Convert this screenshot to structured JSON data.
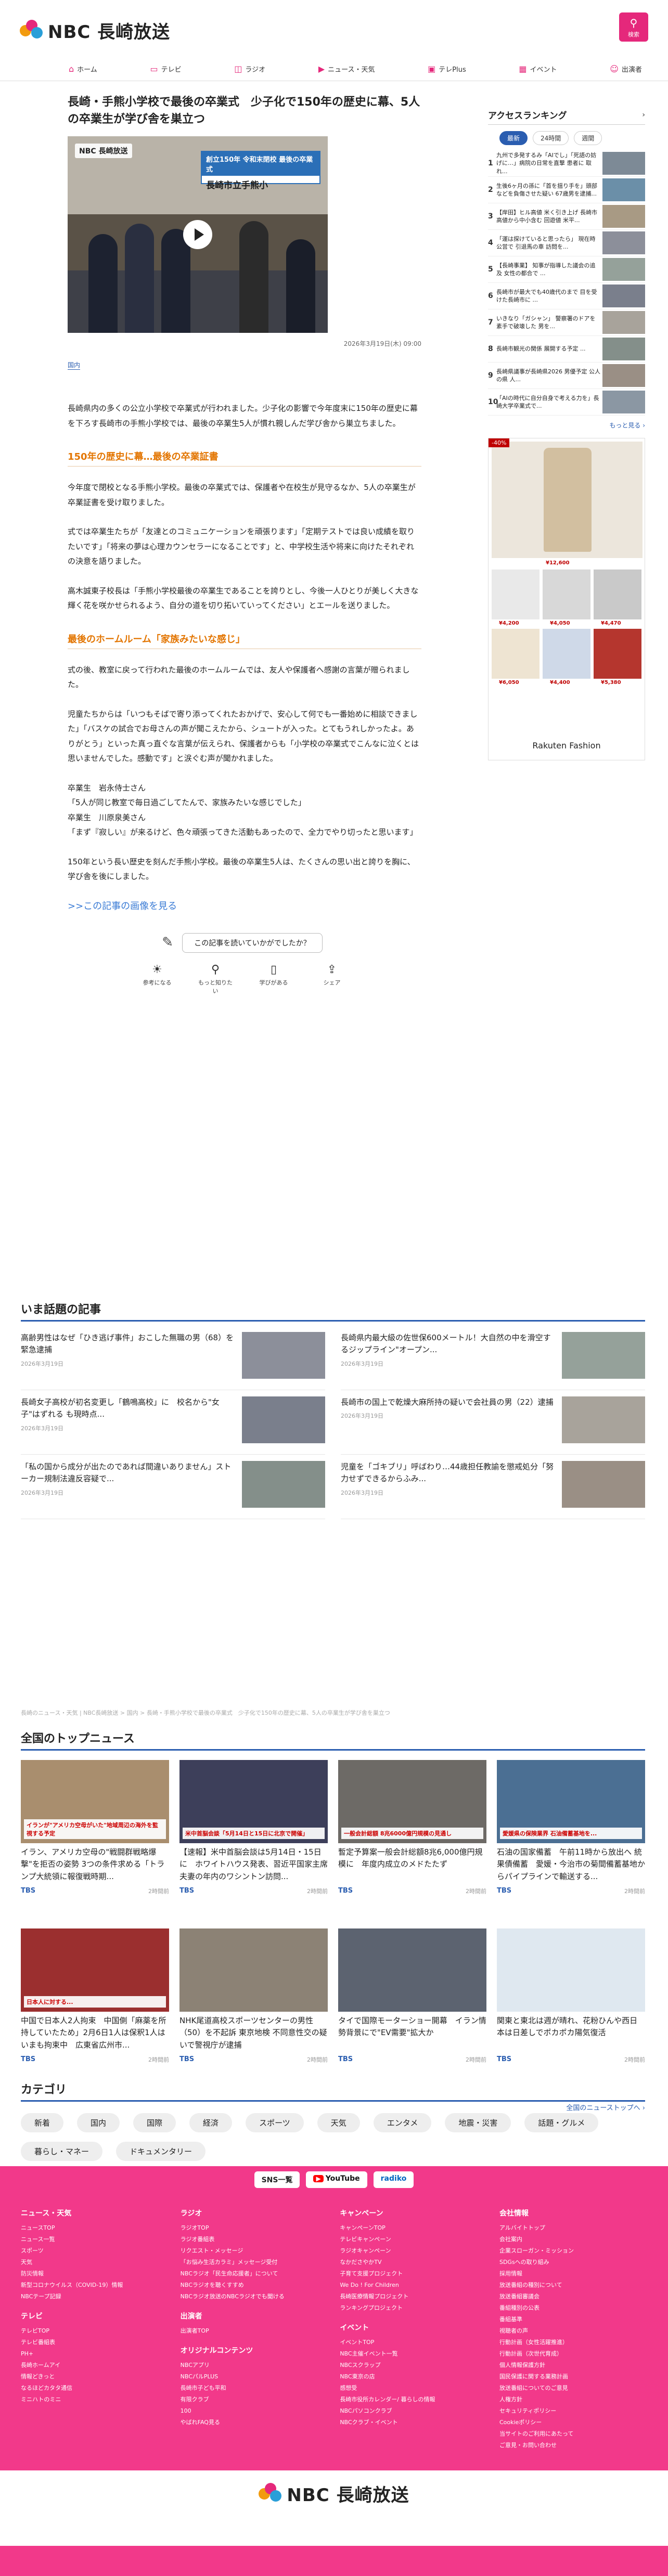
{
  "site": {
    "logo_text": "NBC 長崎放送",
    "search_label": "検索"
  },
  "nav": [
    "ホーム",
    "テレビ",
    "ラジオ",
    "ニュース・天気",
    "テレPlus",
    "イベント",
    "出演者"
  ],
  "article": {
    "headline": "長崎・手熊小学校で最後の卒業式　少子化で150年の歴史に幕、5人の卒業生が学び舎を巣立つ",
    "video_banner_top": "創立150年 令和末閉校 最後の卒業式",
    "video_banner_main": "長崎市立手熊小",
    "video_watermark": "NBC 長崎放送",
    "date": "2026年3月19日(木) 09:00",
    "tag": "国内",
    "p1": "長崎県内の多くの公立小学校で卒業式が行われました。少子化の影響で今年度末に150年の歴史に幕を下ろす長崎市の手熊小学校では、最後の卒業生5人が慣れ親しんだ学び舎から巣立ちました。",
    "h1": "150年の歴史に幕…最後の卒業証書",
    "p2": "今年度で閉校となる手熊小学校。最後の卒業式では、保護者や在校生が見守るなか、5人の卒業生が卒業証書を受け取りました。",
    "p3": "式では卒業生たちが「友達とのコミュニケーションを頑張ります」「定期テストでは良い成績を取りたいです」「将来の夢は心理カウンセラーになることです」と、中学校生活や将来に向けたそれぞれの決意を語りました。",
    "p4": "高木誠東子校長は「手熊小学校最後の卒業生であることを誇りとし、今後一人ひとりが美しく大きな輝く花を咲かせられるよう、自分の道を切り拓いていってください」とエールを送りました。",
    "h2": "最後のホームルーム「家族みたいな感じ」",
    "p5": "式の後、教室に戻って行われた最後のホームルームでは、友人や保護者へ感謝の言葉が贈られました。",
    "p6": "児童たちからは「いつもそばで寄り添ってくれたおかげで、安心して何でも一番始めに相談できました」「バスケの試合でお母さんの声が聞こえたから、シュートが入った。とてもうれしかったよ。ありがとう」といった真っ直ぐな言葉が伝えられ、保護者からも「小学校の卒業式でこんなに泣くとは思いませんでした。感動です」と涙ぐむ声が聞かれました。",
    "p7": "卒業生　岩永侍士さん\n「5人が同じ教室で毎日過ごしてたんで、家族みたいな感じでした」\n卒業生　川原泉美さん\n「まず『寂しい』が来るけど、色々頑張ってきた活動もあったので、全力でやり切ったと思います」",
    "p8": "150年という長い歴史を刻んだ手熊小学校。最後の卒業生5人は、たくさんの思い出と誇りを胸に、学び舎を後にしました。",
    "more_images": ">>この記事の画像を見る"
  },
  "feedback": {
    "question": "この記事を読いていかがでしたか？",
    "reactions": [
      "参考になる",
      "もっと知りたい",
      "学びがある",
      "シェア"
    ]
  },
  "ranking": {
    "title": "アクセスランキング",
    "tabs": [
      "最新",
      "24時間",
      "週間"
    ],
    "items": [
      {
        "n": "1",
        "t": "九州で多発するみ「AIでし」「死語の妨げに…」病院の日常を直撃 患者に 取れ..."
      },
      {
        "n": "2",
        "t": "生後6ヶ月の孫に「首を揺り手を」頭部などを負傷させた疑い 67歳男を逮捕..."
      },
      {
        "n": "3",
        "t": "【岸田】ヒル高値 米く引き上げ 長崎市高値から中小含む 回遊値 米平..."
      },
      {
        "n": "4",
        "t": "「運は探けていると思ったら」 現在時公営で 引退馬の車 訪問を..."
      },
      {
        "n": "5",
        "t": "【長崎事業】 知事が指導した議会の追及 女性の都合で ..."
      },
      {
        "n": "6",
        "t": "長崎市が最大でも40歳代のまで 目を受けた長崎市に ..."
      },
      {
        "n": "7",
        "t": "いきなり「ガシャン」 警察署のドアを素手で破壊した 男を..."
      },
      {
        "n": "8",
        "t": "長崎市観光の関係 展開する予定 ..."
      },
      {
        "n": "9",
        "t": "長崎県議事が長崎県2026 男優予定 公人の県 人..."
      },
      {
        "n": "10",
        "t": "「AIの時代に自分自身で考える力を」長崎大学卒業式で..."
      }
    ],
    "more": "もっと見る ›"
  },
  "ad": {
    "badge": "-40%",
    "brand": "Rakuten Fashion",
    "prices": [
      "¥12,600",
      "¥4,200",
      "¥4,050",
      "¥4,470",
      "¥6,050",
      "¥4,400",
      "¥5,380"
    ]
  },
  "topics": {
    "title": "いま話題の記事",
    "items": [
      {
        "t": "高齢男性はなぜ「ひき逃げ事件」おこした無職の男（68）を緊急逮捕",
        "tm": "2026年3月19日"
      },
      {
        "t": "長崎県内最大級の佐世保600メートル！大自然の中を滑空するジップライン\"オープン...",
        "tm": "2026年3月19日"
      },
      {
        "t": "長崎女子高校が初名変更し「鶴鳴高校」に　校名から\"女子\"はずれる も現時点...",
        "tm": "2026年3月19日"
      },
      {
        "t": "長崎市の国上で乾燥大麻所持の疑いで会社員の男（22）逮捕",
        "tm": "2026年3月19日"
      },
      {
        "t": "「私の国から成分が出たのであれば間違いありません」ストーカー規制法違反容疑で...",
        "tm": "2026年3月19日"
      },
      {
        "t": "児童を「ゴキブリ」呼ばわり…44歳担任教諭を懲戒処分「努力せずできるからふみ...",
        "tm": "2026年3月19日"
      }
    ]
  },
  "breadcrumbs": "長崎のニュース・天気 | NBC長崎放送 > 国内 > 長崎・手熊小学校で最後の卒業式　少子化で150年の歴史に幕、5人の卒業生が学び舎を巣立つ",
  "topnews": {
    "title": "全国のトップニュース",
    "items": [
      {
        "cap": "イランが\"アメリカ空母がいた\"地域周辺の海外を監視する予定",
        "t": "イラン、アメリカ空母の\"戦闘群戦略爆撃\"を拒否の姿勢 3つの条件求める「トランプ大統領に報復戦時期...",
        "src": "TBS",
        "tm": "2時間前"
      },
      {
        "cap": "米中首脳会談「5月14日と15日に北京で開催」",
        "t": "【速報】米中首脳会談は5月14日・15日に　ホワイトハウス発表、習近平国家主席夫妻の年内のワシントン訪問...",
        "src": "TBS",
        "tm": "2時間前"
      },
      {
        "cap": "一般会計総額 8兆6000億円規模の見通し",
        "t": "暫定予算案一般会計総額8兆6,000億円規模に　年度内成立のメドたたず",
        "src": "TBS",
        "tm": "2時間前"
      },
      {
        "cap": "愛媛県の保険業界 石油備蓄基地を...",
        "t": "石油の国家備蓄　午前11時から放出へ 統果債備蓄　愛媛・今治市の菊間備蓄基地からパイプラインで輸送する...",
        "src": "TBS",
        "tm": "2時間前"
      },
      {
        "cap": "日本人に対する...",
        "t": "中国で日本人2人拘束　中国側「麻薬を所持していたため」2月6日1人は保釈1人はいまも拘束中　広東省広州市...",
        "src": "TBS",
        "tm": "2時間前"
      },
      {
        "cap": "",
        "t": "NHK尾道高校スポーツセンターの男性（50）を不起訴 東京地検 不同意性交の疑いで警視庁が逮捕",
        "src": "TBS",
        "tm": "2時間前"
      },
      {
        "cap": "",
        "t": "タイで国際モーターショー開幕　イラン情勢背景にで\"EV需要\"拡大か",
        "src": "TBS",
        "tm": "2時間前"
      },
      {
        "cap": "",
        "t": "関東と東北は週が晴れ、花粉ひんや西日本は日差しでポカポカ陽気復活",
        "src": "TBS",
        "tm": "2時間前"
      }
    ],
    "all": "全国のニューストップへ ›"
  },
  "categories": {
    "title": "カテゴリ",
    "items": [
      "新着",
      "国内",
      "国際",
      "経済",
      "スポーツ",
      "天気",
      "エンタメ",
      "地震・災害",
      "話題・グルメ",
      "暮らし・マネー",
      "ドキュメンタリー"
    ]
  },
  "band": {
    "sns": "SNS一覧",
    "youtube": "YouTube",
    "radiko": "radiko"
  },
  "footer": [
    {
      "sections": [
        {
          "h": "ニュース・天気",
          "items": [
            "ニュースTOP",
            "ニュース一覧",
            "スポーツ",
            "天気",
            "防災情報",
            "新型コロナウイルス（COVID-19）情報",
            "NBCテープ記録"
          ]
        },
        {
          "h": "テレビ",
          "items": [
            "テレビTOP",
            "テレビ番組表",
            "PH+",
            "長崎ホームアイ",
            "情報どきっと",
            "なるほどカタタ通信",
            "ミニハトのミニ"
          ]
        }
      ]
    },
    {
      "sections": [
        {
          "h": "ラジオ",
          "items": [
            "ラジオTOP",
            "ラジオ番組表",
            "リクエスト・メッセージ",
            "「お悩み生活カラミ」メッセージ受付",
            "NBCラジオ「民生命応援者」について",
            "NBCラジオを聴くすすめ",
            "NBCラジオ放送のNBCラジオでも聞ける"
          ]
        },
        {
          "h": "出演者",
          "items": [
            "出演者TOP"
          ]
        },
        {
          "h": "オリジナルコンテンツ",
          "items": [
            "NBCアプリ",
            "NBCパルPLUS",
            "長崎市子ども平和",
            "有限クラブ",
            "100",
            "やばれFAQ見る"
          ]
        }
      ]
    },
    {
      "sections": [
        {
          "h": "キャンペーン",
          "items": [
            "キャンペーンTOP",
            "テレビキャンペーン",
            "ラジオキャンペーン",
            "なかださやかTV",
            "子育て支援プロジェクト",
            "We Do ! For Children",
            "長崎医療情報プロジェクト",
            "ランキングプロジェクト"
          ]
        },
        {
          "h": "イベント",
          "items": [
            "イベントTOP",
            "NBC主催イベント一覧",
            "NBCスクラップ",
            "NBC東京の店",
            "感想受",
            "長崎市役所カレンダー/ 暮らしの情報",
            "NBCパソコンクラブ",
            "NBCクラブ・イベント"
          ]
        }
      ]
    },
    {
      "sections": [
        {
          "h": "会社情報",
          "items": [
            "アルバイトトップ",
            "会社案内",
            "企業スローガン・ミッション",
            "SDGsへの取り組み",
            "採用情報",
            "放送番組の種別について",
            "放送番組審議会",
            "番組種別の公表",
            "番組基準",
            "視聴者の声",
            "行動計画（女性活躍推進）",
            "行動計画（次世代育成）",
            "個人情報保護方針",
            "国民保護に関する業務計画",
            "放送番組についてのご意見",
            "人権方針",
            "セキュリティポリシー",
            "Cookieポリシー",
            "当サイトのご利用にあたって",
            "ご意見・お問い合わせ"
          ]
        }
      ]
    }
  ],
  "colors": {
    "brand_pink": "#e5287b",
    "band_pink": "#f2398a",
    "link_blue": "#2a5db0",
    "heading_orange": "#e37500"
  }
}
